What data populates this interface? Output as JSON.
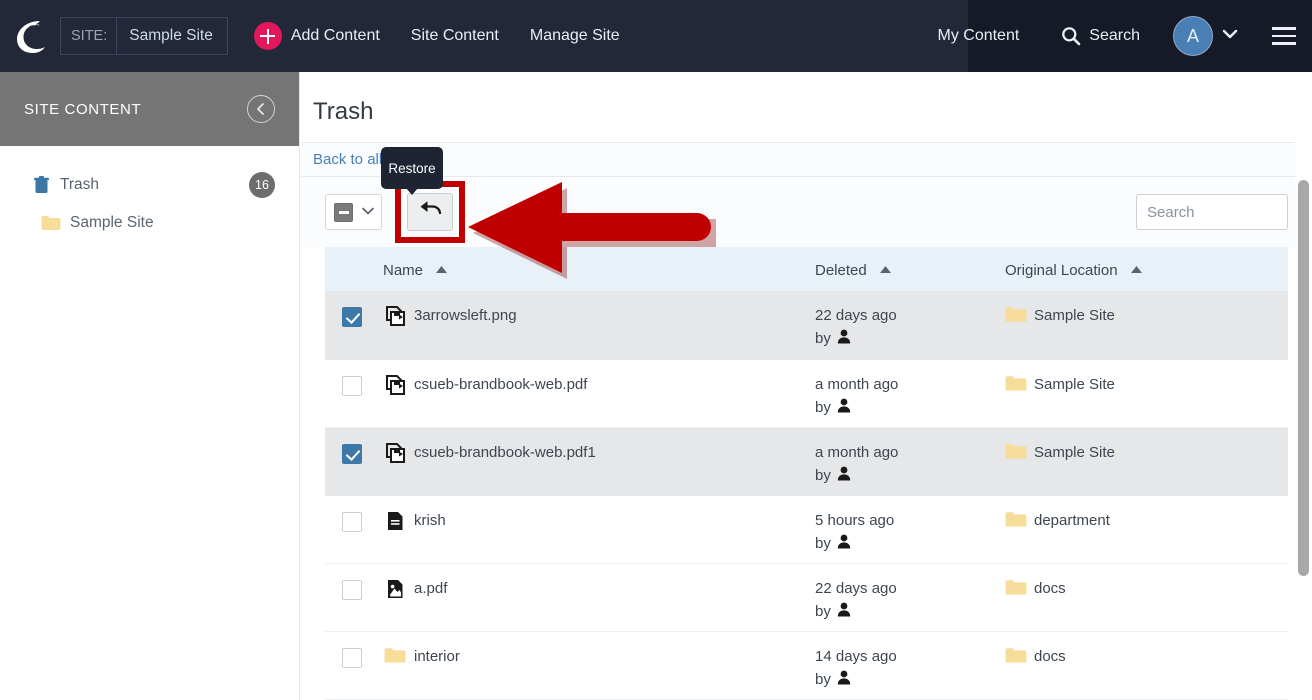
{
  "topbar": {
    "logo_icon": "crescent-logo-icon",
    "site_label": "SITE:",
    "site_value": "Sample Site",
    "add_content": "Add Content",
    "site_content": "Site Content",
    "manage_site": "Manage Site",
    "my_content": "My Content",
    "search": "Search",
    "search_icon": "search-icon",
    "avatar_initial": "A",
    "avatar_chevron_icon": "chevron-down-icon",
    "menu_icon": "hamburger-menu-icon",
    "accent_color": "#e5175c",
    "bg_color": "#232839",
    "bg_color_right": "#151a26"
  },
  "sidebar": {
    "title": "SITE CONTENT",
    "collapse_icon": "chevron-left-icon",
    "items": [
      {
        "label": "Trash",
        "icon": "trash-icon",
        "badge": "16",
        "level": 1
      },
      {
        "label": "Sample Site",
        "icon": "folder-icon",
        "badge": "",
        "level": 2
      }
    ],
    "header_bg": "#757575"
  },
  "main": {
    "page_title": "Trash",
    "back_link": "Back to all",
    "toolbar": {
      "select_all_state": "indeterminate",
      "select_all_chevron_icon": "chevron-down-icon",
      "restore_button_label": "Restore",
      "restore_icon": "undo-arrow-icon",
      "tooltip_text": "Restore"
    },
    "search": {
      "placeholder": "Search",
      "value": ""
    },
    "table": {
      "columns": [
        {
          "key": "check",
          "label": "",
          "sortable": false
        },
        {
          "key": "name",
          "label": "Name",
          "sort": "asc"
        },
        {
          "key": "deleted",
          "label": "Deleted",
          "sort": "asc"
        },
        {
          "key": "location",
          "label": "Original Location",
          "sort": "asc"
        }
      ],
      "rows": [
        {
          "checked": true,
          "icon": "image-file-icon",
          "name": "3arrowsleft.png",
          "deleted": "22 days ago",
          "by": "by",
          "by_icon": "user-icon",
          "location": "Sample Site",
          "location_icon": "folder-icon"
        },
        {
          "checked": false,
          "icon": "image-file-icon",
          "name": "csueb-brandbook-web.pdf",
          "deleted": "a month ago",
          "by": "by",
          "by_icon": "user-icon",
          "location": "Sample Site",
          "location_icon": "folder-icon"
        },
        {
          "checked": true,
          "icon": "image-file-icon",
          "name": "csueb-brandbook-web.pdf1",
          "deleted": "a month ago",
          "by": "by",
          "by_icon": "user-icon",
          "location": "Sample Site",
          "location_icon": "folder-icon"
        },
        {
          "checked": false,
          "icon": "document-file-icon",
          "name": "krish",
          "deleted": "5 hours ago",
          "by": "by",
          "by_icon": "user-icon",
          "location": "department",
          "location_icon": "folder-icon"
        },
        {
          "checked": false,
          "icon": "pdf-file-icon",
          "name": "a.pdf",
          "deleted": "22 days ago",
          "by": "by",
          "by_icon": "user-icon",
          "location": "docs",
          "location_icon": "folder-icon"
        },
        {
          "checked": false,
          "icon": "folder-icon",
          "name": "interior",
          "deleted": "14 days ago",
          "by": "by",
          "by_icon": "user-icon",
          "location": "docs",
          "location_icon": "folder-icon"
        }
      ]
    },
    "scrollbar": {
      "name": "vertical-scrollbar"
    }
  },
  "annotation": {
    "arrow_icon": "red-left-arrow-annotation",
    "highlight_color": "#c00000",
    "arrow_color": "#c00000"
  }
}
